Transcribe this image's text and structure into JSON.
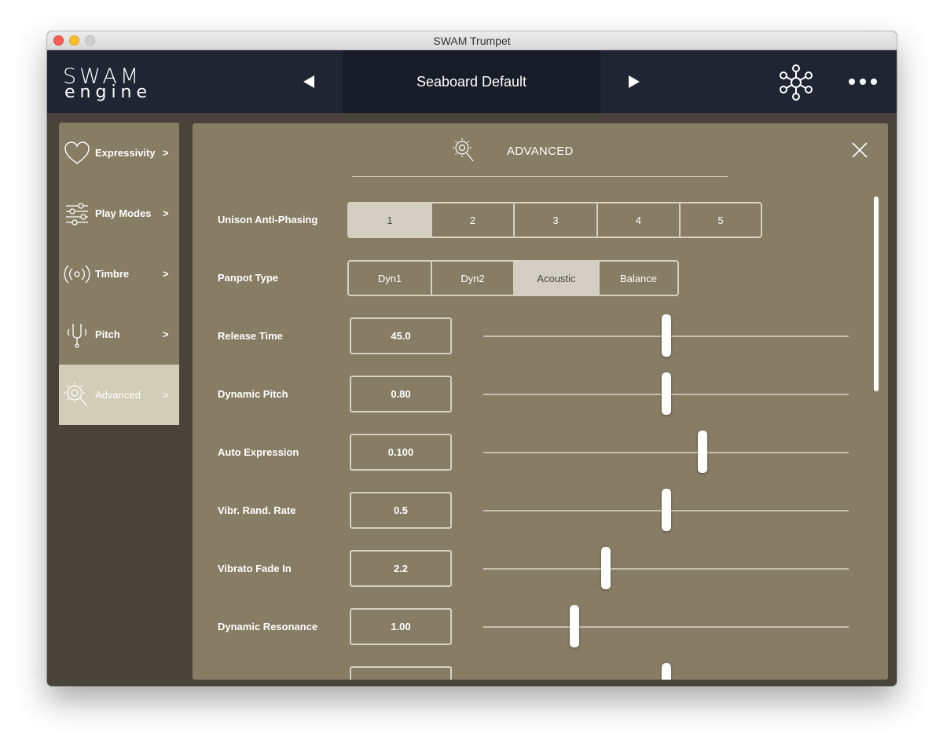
{
  "window": {
    "title": "SWAM Trumpet"
  },
  "header": {
    "logo_top": "SWAM",
    "logo_bottom": "engine",
    "preset_name": "Seaboard Default",
    "prev_icon": "triangle-left-icon",
    "next_icon": "triangle-right-icon",
    "network_icon": "network-nodes-icon",
    "more_icon": "more-dots-icon"
  },
  "sidebar": {
    "items": [
      {
        "label": "Expressivity",
        "arrow": ">",
        "icon": "heart-icon",
        "active": false
      },
      {
        "label": "Play Modes",
        "arrow": ">",
        "icon": "sliders-icon",
        "active": false
      },
      {
        "label": "Timbre",
        "arrow": ">",
        "icon": "broadcast-icon",
        "active": false
      },
      {
        "label": "Pitch",
        "arrow": ">",
        "icon": "tuning-fork-icon",
        "active": false
      },
      {
        "label": "Advanced",
        "arrow": ">",
        "icon": "advanced-gear-icon",
        "active": true
      }
    ]
  },
  "panel": {
    "title": "ADVANCED",
    "close_icon": "close-icon",
    "unison": {
      "label": "Unison Anti-Phasing",
      "options": [
        "1",
        "2",
        "3",
        "4",
        "5"
      ],
      "selected": "1"
    },
    "panpot": {
      "label": "Panpot Type",
      "options": [
        "Dyn1",
        "Dyn2",
        "Acoustic",
        "Balance"
      ],
      "selected": "Acoustic"
    },
    "sliders": [
      {
        "label": "Release Time",
        "value": "45.0",
        "position": 0.5
      },
      {
        "label": "Dynamic Pitch",
        "value": "0.80",
        "position": 0.5
      },
      {
        "label": "Auto Expression",
        "value": "0.100",
        "position": 0.6
      },
      {
        "label": "Vibr. Rand. Rate",
        "value": "0.5",
        "position": 0.5
      },
      {
        "label": "Vibrato Fade In",
        "value": "2.2",
        "position": 0.335
      },
      {
        "label": "Dynamic Resonance",
        "value": "1.00",
        "position": 0.25
      },
      {
        "label": "",
        "value": "",
        "position": 0.5
      }
    ]
  },
  "colors": {
    "header_bg": "#1f2533",
    "panel_bg": "#877c64",
    "window_bg": "#4a433c",
    "active_item": "#d1cdb7",
    "selected_segment": "#d3cec3"
  }
}
